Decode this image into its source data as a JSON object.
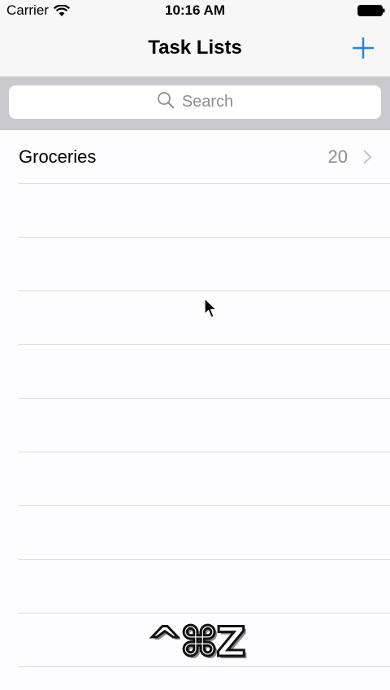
{
  "status_bar": {
    "carrier": "Carrier",
    "time": "10:16 AM",
    "wifi_icon": "wifi-icon",
    "battery_icon": "battery-icon"
  },
  "nav": {
    "title": "Task Lists",
    "add_icon": "plus-icon",
    "accent_color": "#1a82fb"
  },
  "search": {
    "placeholder": "Search",
    "icon": "search-icon"
  },
  "lists": [
    {
      "name": "Groceries",
      "count": "20"
    }
  ],
  "shortcut_overlay": "^⌘Z"
}
